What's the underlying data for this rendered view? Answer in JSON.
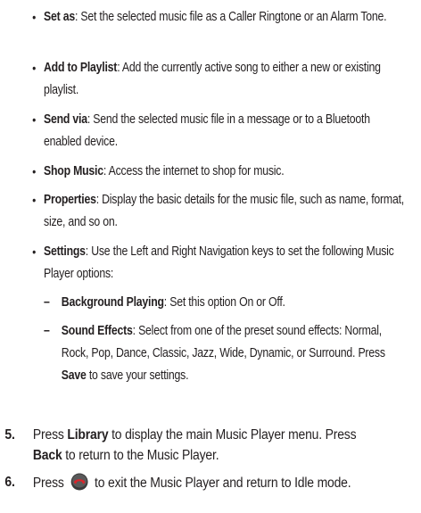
{
  "bullets": [
    {
      "term": "Set as",
      "text": ": Set the selected music file as a Caller Ringtone or an Alarm Tone."
    },
    {
      "term": "Add to Playlist",
      "text": ": Add the currently active song to either a new or existing playlist."
    },
    {
      "term": "Send via",
      "text": ": Send the selected music file in a message or to a Bluetooth enabled device."
    },
    {
      "term": "Shop Music",
      "text": ": Access the internet to shop for music."
    },
    {
      "term": "Properties",
      "text": ": Display the basic details for the music file, such as name, format, size, and so on."
    },
    {
      "term": "Settings",
      "text": ": Use the Left and Right Navigation keys to set the following Music Player options:"
    }
  ],
  "sub_bullets": [
    {
      "dash": "–",
      "term": "Background Playing",
      "text": ": Set this option On or Off."
    },
    {
      "dash": "–",
      "term": "Sound Effects",
      "text": ": Select from one of the preset sound effects: Normal, Rock, Pop, Dance, Classic, Jazz, Wide, Dynamic, or Surround. Press ",
      "key": "Save",
      "tail": " to save your settings."
    }
  ],
  "bullet_marker": "•",
  "steps": [
    {
      "num": "5.",
      "a": "Press ",
      "k1": "Library",
      "b": " to display the main Music Player menu. Press ",
      "k2": "Back",
      "c": " to return to the Music Player."
    },
    {
      "num": "6.",
      "a": "Press ",
      "icon": "end-call-key-icon",
      "b": " to exit the Music Player and return to Idle mode."
    }
  ],
  "colors": {
    "text": "#231f20",
    "end_key": "#d9262c"
  }
}
